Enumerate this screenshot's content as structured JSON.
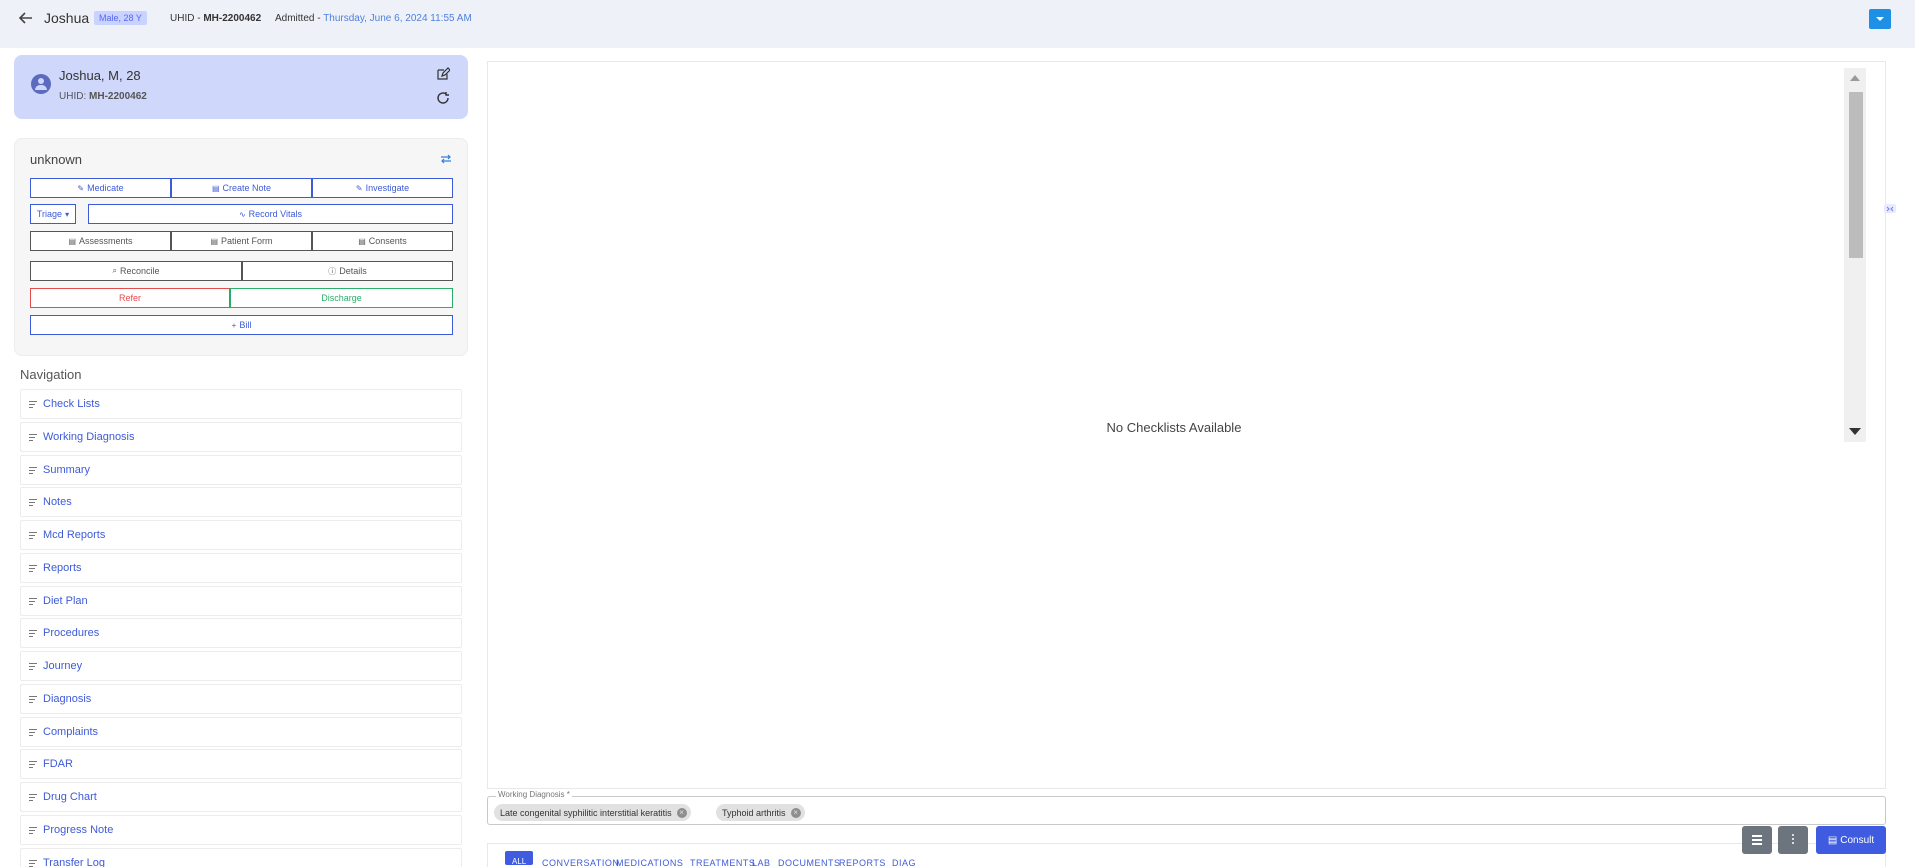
{
  "header": {
    "patient_name": "Joshua",
    "gender_age_badge": "Male, 28 Y",
    "uhid_label": "UHID -",
    "uhid_value": "MH-2200462",
    "admitted_label": "Admitted -",
    "admitted_date": "Thursday, June 6, 2024 11:55 AM"
  },
  "patient_card": {
    "name_line": "Joshua, M, 28",
    "uhid_label": "UHID:",
    "uhid_value": "MH-2200462"
  },
  "actions": {
    "location": "unknown",
    "medicate": "Medicate",
    "create_note": "Create Note",
    "investigate": "Investigate",
    "triage": "Triage",
    "record_vitals": "Record Vitals",
    "assessments": "Assessments",
    "patient_form": "Patient Form",
    "consents": "Consents",
    "reconcile": "Reconcile",
    "details": "Details",
    "refer": "Refer",
    "discharge": "Discharge",
    "bill": "Bill"
  },
  "navigation": {
    "title": "Navigation",
    "items": [
      "Check Lists",
      "Working Diagnosis",
      "Summary",
      "Notes",
      "Mcd Reports",
      "Reports",
      "Diet Plan",
      "Procedures",
      "Journey",
      "Diagnosis",
      "Complaints",
      "FDAR",
      "Drug Chart",
      "Progress Note",
      "Transfer Log"
    ]
  },
  "main": {
    "empty_message": "No Checklists Available"
  },
  "working_diagnosis": {
    "label": "Working Diagnosis *",
    "chips": [
      "Late congenital syphilitic interstitial keratitis",
      "Typhoid arthritis"
    ]
  },
  "bottom_tabs": [
    "ALL",
    "CONVERSATION",
    "MEDICATIONS",
    "TREATMENTS",
    "LAB",
    "DOCUMENTS",
    "REPORTS",
    "DIAG"
  ],
  "floating": {
    "consult": "Consult"
  },
  "colors": {
    "accent": "#3f5be0",
    "header_bg": "#eef2f8",
    "card_bg": "#cfd8fb",
    "refer": "#e34c4c",
    "discharge": "#2cae6b"
  }
}
